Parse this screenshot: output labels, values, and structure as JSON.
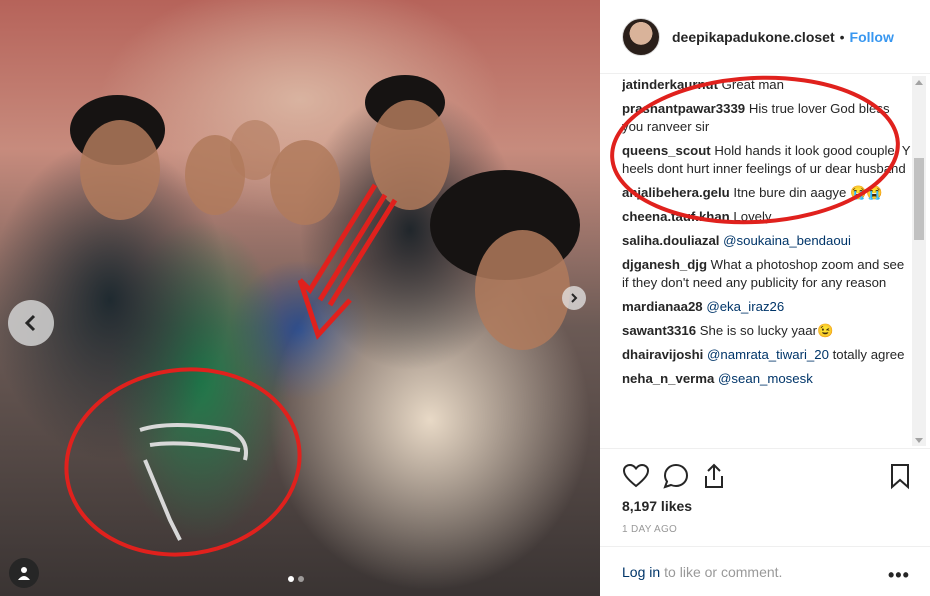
{
  "post": {
    "username": "deepikapadukone.closet",
    "follow_label": "Follow",
    "separator": "•"
  },
  "comments": [
    {
      "user": "jatinderkaurnut",
      "text": "Great man"
    },
    {
      "user": "prashantpawar3339",
      "text": "His true lover God bless you ranveer sir"
    },
    {
      "user": "queens_scout",
      "text": "Hold hands it look good couple. Y heels dont hurt inner feelings of ur dear husband"
    },
    {
      "user": "anjalibehera.gelu",
      "text": "Itne bure din aagye 😭😭"
    },
    {
      "user": "cheena.tauf.khan",
      "text": "Lovely"
    },
    {
      "user": "saliha.douliazal",
      "mention": "@soukaina_bendaoui",
      "text": ""
    },
    {
      "user": "djganesh_djg",
      "text": "What a photoshop zoom and see if they don't need any publicity for any reason"
    },
    {
      "user": "mardianaa28",
      "mention": "@eka_iraz26",
      "text": ""
    },
    {
      "user": "sawant3316",
      "text": "She is so lucky yaar😉"
    },
    {
      "user": "dhairavijoshi",
      "mention": "@namrata_tiwari_20",
      "text": "totally agree"
    },
    {
      "user": "neha_n_verma",
      "mention": "@sean_mosesk",
      "text": ""
    }
  ],
  "likes": "8,197 likes",
  "time_ago": "1 DAY AGO",
  "footer": {
    "login_link": "Log in",
    "login_rest": "to like or comment."
  },
  "icons": [
    "heart-icon",
    "comment-icon",
    "share-icon",
    "bookmark-icon",
    "chevron-left-icon",
    "chevron-right-icon",
    "user-tag-icon",
    "more-options-icon"
  ],
  "colors": {
    "accent": "#3897f0",
    "link": "#003569",
    "text": "#262626",
    "muted": "#999999",
    "annotation_red": "#e0211d"
  },
  "carousel": {
    "total": 2,
    "active": 1
  }
}
